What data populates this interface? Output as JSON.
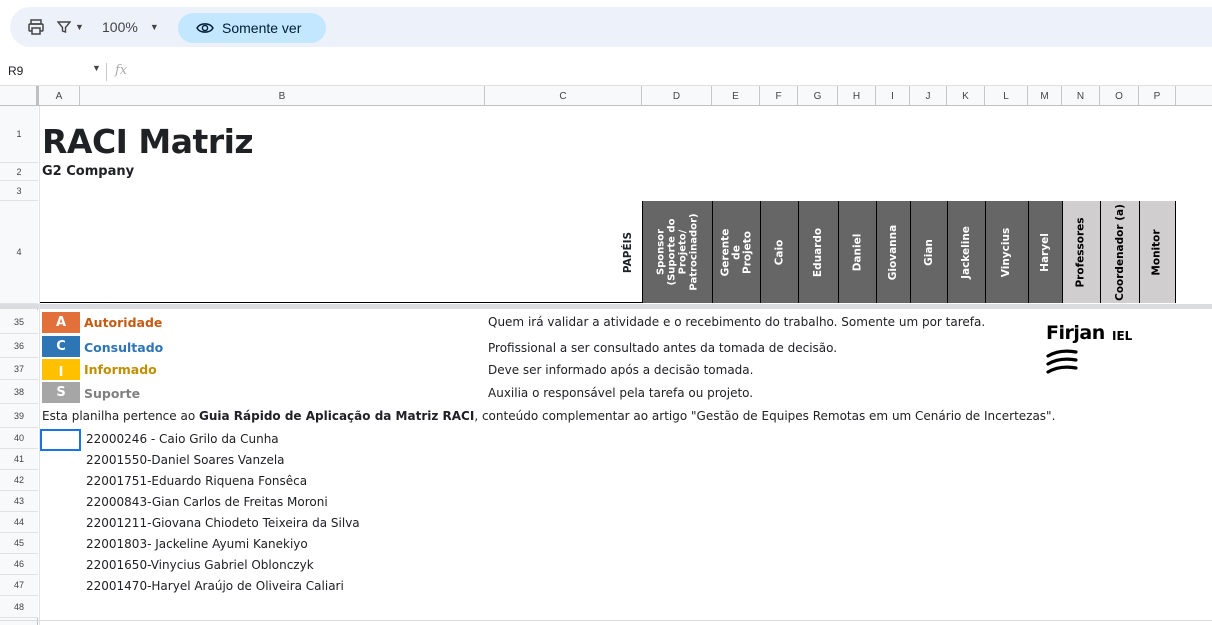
{
  "toolbar": {
    "zoom": "100%",
    "view_mode": "Somente ver"
  },
  "formula_bar": {
    "cell_ref": "R9",
    "fx": "fx"
  },
  "columns": [
    "A",
    "B",
    "C",
    "D",
    "E",
    "F",
    "G",
    "H",
    "I",
    "J",
    "K",
    "L",
    "M",
    "N",
    "O",
    "P"
  ],
  "rows": [
    "1",
    "2",
    "3",
    "4",
    "35",
    "36",
    "37",
    "38",
    "39",
    "40",
    "41",
    "42",
    "43",
    "44",
    "45",
    "46",
    "47",
    "48"
  ],
  "sheet": {
    "title": "RACI Matriz",
    "company": "G2 Company",
    "papeis_label": "PAPÉIS",
    "roles": [
      {
        "label": "Sponsor (Suporte do Projeto/ Patrocinador)",
        "style": "dark"
      },
      {
        "label": "Gerente de Projeto",
        "style": "dark"
      },
      {
        "label": "Caio",
        "style": "dark"
      },
      {
        "label": "Eduardo",
        "style": "dark"
      },
      {
        "label": "Daniel",
        "style": "dark"
      },
      {
        "label": "Giovanna",
        "style": "dark"
      },
      {
        "label": "Gian",
        "style": "dark"
      },
      {
        "label": "Jackeline",
        "style": "dark"
      },
      {
        "label": "Vinycius",
        "style": "dark"
      },
      {
        "label": "Haryel",
        "style": "dark"
      },
      {
        "label": "Professores",
        "style": "light"
      },
      {
        "label": "Coordenador (a)",
        "style": "light"
      },
      {
        "label": "Monitor",
        "style": "light"
      }
    ],
    "legend": [
      {
        "letter": "A",
        "label": "Autoridade",
        "color": "#e2703a",
        "text_color": "#c55a11",
        "description": "Quem irá validar a atividade e o recebimento do trabalho. Somente um por tarefa."
      },
      {
        "letter": "C",
        "label": "Consultado",
        "color": "#2e75b6",
        "text_color": "#2e75b6",
        "description": "Profissional a ser consultado antes da tomada de decisão."
      },
      {
        "letter": "I",
        "label": "Informado",
        "color": "#ffc000",
        "text_color": "#bf8f00",
        "description": "Deve ser informado após a decisão tomada."
      },
      {
        "letter": "S",
        "label": "Suporte",
        "color": "#a6a6a6",
        "text_color": "#7f7f7f",
        "description": "Auxilia o responsável pela tarefa ou projeto."
      }
    ],
    "note_prefix": "Esta planilha pertence ao ",
    "note_bold": "Guia Rápido de Aplicação da Matriz RACI",
    "note_suffix": ", conteúdo complementar ao artigo \"Gestão de Equipes Remotas em um Cenário de Incertezas\".",
    "members": [
      "22000246 - Caio Grilo da Cunha",
      "22001550-Daniel Soares Vanzela",
      "22001751-Eduardo Riquena Fonsêca",
      "22000843-Gian Carlos de Freitas Moroni",
      "22001211-Giovana Chiodeto Teixeira da Silva",
      "22001803- Jackeline Ayumi Kanekiyo",
      "22001650-Vinycius Gabriel Oblonczyk",
      "22001470-Haryel Araújo de Oliveira Caliari"
    ],
    "logo_text": "Firjan",
    "logo_sub": "IEL"
  }
}
